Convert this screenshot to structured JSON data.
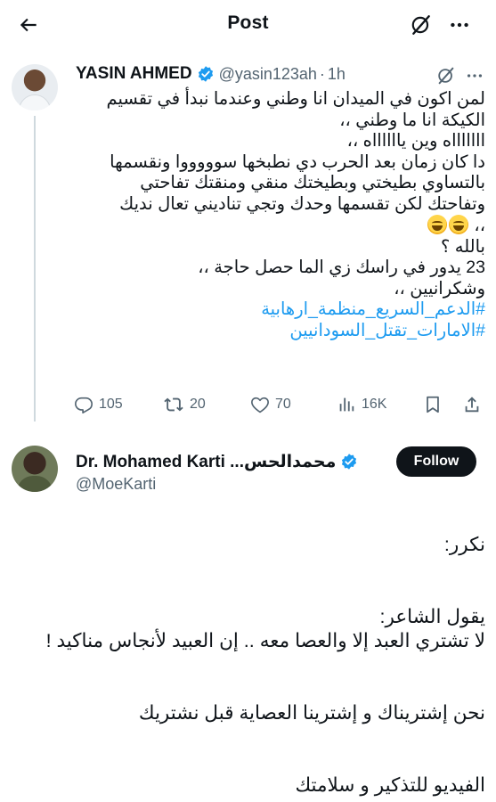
{
  "header": {
    "title": "Post",
    "back_icon": "arrow-left-icon",
    "grok_icon": "grok-icon",
    "more_icon": "more-horizontal-icon"
  },
  "parent_tweet": {
    "name": "YASIN AHMED",
    "handle": "@yasin123ah",
    "separator": "·",
    "time": "1h",
    "verified": true,
    "lines": [
      "لمن اكون في الميدان انا وطني وعندما نبدأ في تقسيم",
      "الكيكة انا ما وطني ،،",
      "اااااااه وين يااااااه ،،",
      "دا كان زمان بعد الحرب دي نطبخها سوووووا ونقسمها",
      "بالتساوي بطيختي وبطيختك منقي ومنقتك تفاحتي",
      "وتفاحتك لكن تقسمها وحدك وتجي تناديني تعال نديك",
      "،،",
      "بالله ؟",
      "23 يدور في راسك زي الما حصل حاجة ،،",
      "وشكرانيين ،،"
    ],
    "emoji_count": 2,
    "hashtags": [
      "#الدعم_السريع_منظمة_ارهابية",
      "#الامارات_تقتل_السودانيين"
    ],
    "stats": {
      "replies": "105",
      "reposts": "20",
      "likes": "70",
      "views": "16K"
    }
  },
  "main_tweet": {
    "name": "Dr. Mohamed Karti ...محمدالحس",
    "handle": "@MoeKarti",
    "verified": true,
    "follow_label": "Follow",
    "paragraphs": [
      "نكرر:",
      "",
      "يقول الشاعر:",
      "لا تشتري العبد إلا والعصا معه .. إن العبيد لأنجاس مناكيد !",
      "",
      "نحن إشتريناك و إشترينا العصاية قبل نشتريك",
      "",
      "الفيديو للتذكير و سلامتك"
    ]
  },
  "colors": {
    "accent": "#1d9bf0",
    "text": "#0f1419",
    "muted": "#536471",
    "thread_line": "#cfd9de"
  }
}
